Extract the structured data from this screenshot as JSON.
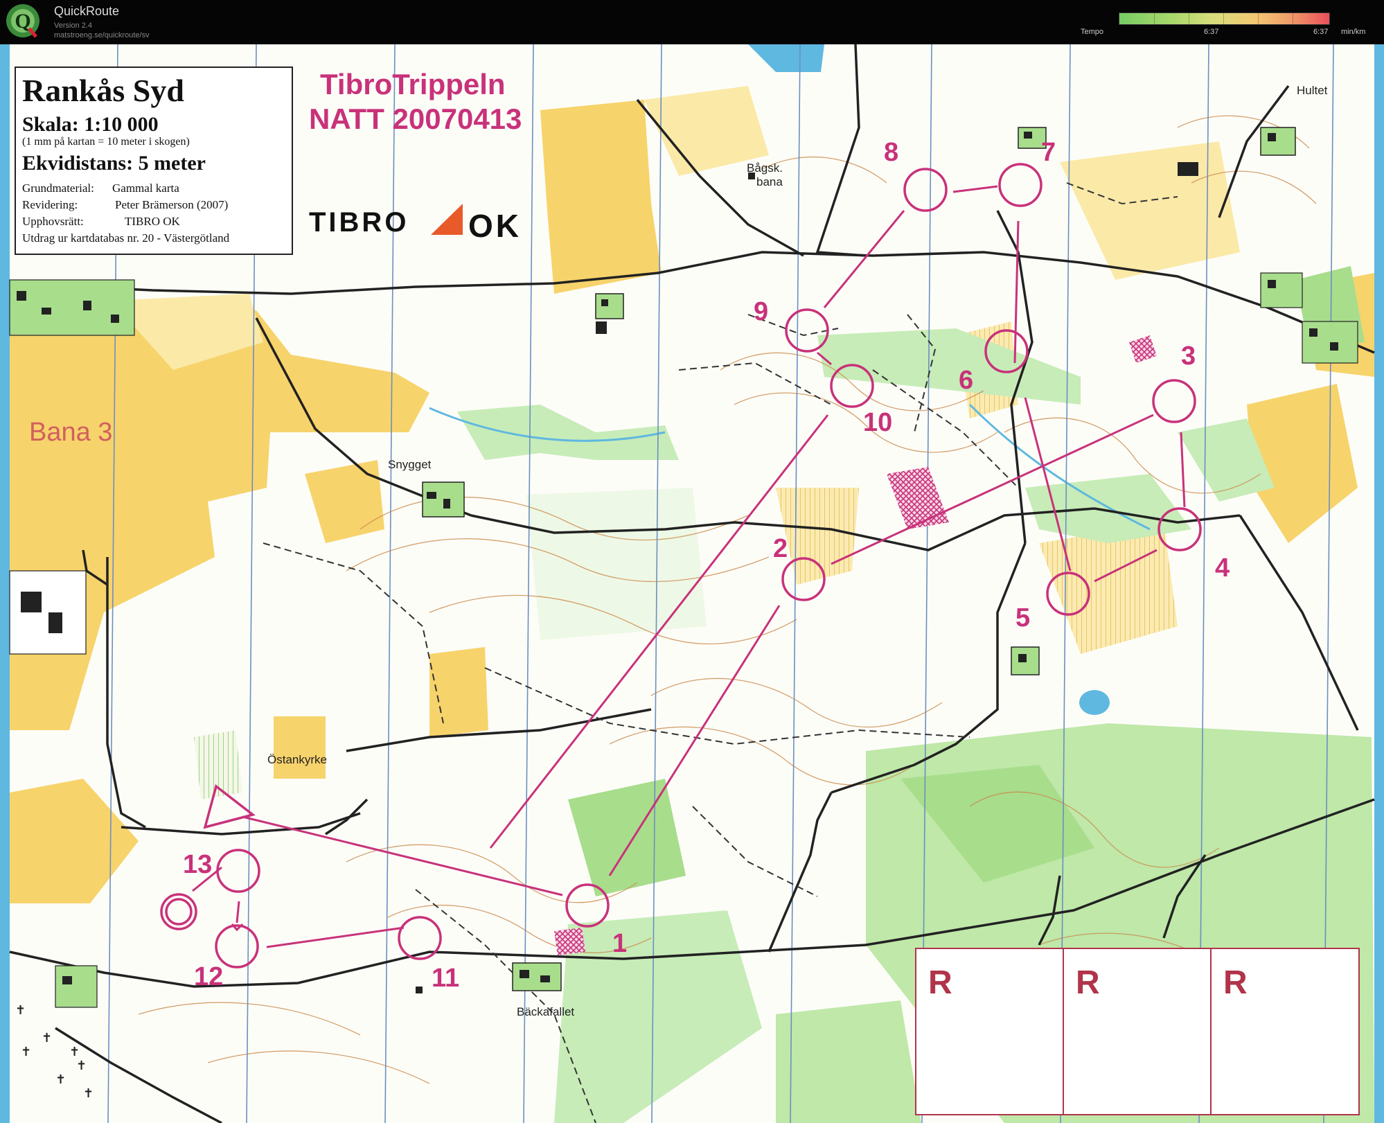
{
  "app": {
    "title": "QuickRoute",
    "version": "Version 2.4",
    "url": "matstroeng.se/quickroute/sv",
    "logo_letter": "Q"
  },
  "legend": {
    "label": "Tempo",
    "val_low": "6:37",
    "val_high": "6:37",
    "unit": "min/km"
  },
  "map": {
    "title": "Rankås Syd",
    "scale": "Skala:  1:10 000",
    "scale_note": "(1 mm på kartan = 10 meter i skogen)",
    "ekvidistans": "Ekvidistans:  5 meter",
    "grund_label": "Grundmaterial:",
    "grund_value": "Gammal karta",
    "revid_label": "Revidering:",
    "revid_value": "Peter Brämerson  (2007)",
    "upph_label": "Upphovsrätt:",
    "upph_value": "TIBRO OK",
    "utdrag": "Utdrag ur kartdatabas nr. 20 - Västergötland",
    "event_line1": "TibroTrippeln",
    "event_line2": "NATT 20070413",
    "club_left": "TIBRO",
    "club_right": "OK",
    "course": "Bana 3",
    "places": {
      "hultet": "Hultet",
      "bagsk1": "Bågsk.",
      "bagsk2": "bana",
      "snygget": "Snygget",
      "ostankyrke": "Östankyrke",
      "backafallet": "Bäckafallet"
    },
    "controls": [
      "1",
      "2",
      "3",
      "4",
      "5",
      "6",
      "7",
      "8",
      "9",
      "10",
      "11",
      "12",
      "13"
    ],
    "rbox": [
      "R",
      "R",
      "R"
    ],
    "colors": {
      "course": "#c8327a",
      "open": "#f7d36b",
      "green": "#8fd47a",
      "contour": "#c9894a",
      "water": "#5fb8e0"
    }
  }
}
